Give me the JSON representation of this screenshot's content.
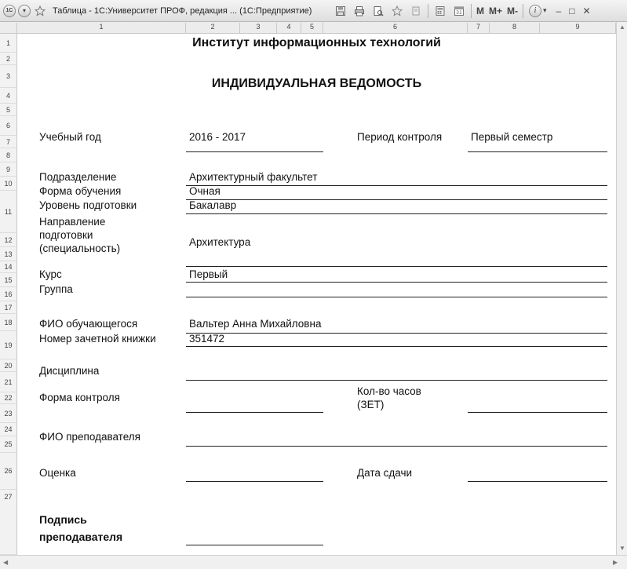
{
  "window": {
    "title": "Таблица - 1С:Университет ПРОФ, редакция ... (1С:Предприятие)",
    "m_label": "M",
    "m_plus_label": "M+",
    "m_minus_label": "M-",
    "app_icon": "1c-logo-icon",
    "back_icon": "circle-left-icon",
    "forward_icon": "circle-right-icon",
    "star_icon": "star-icon",
    "save_icon": "save-icon",
    "print_icon": "print-icon",
    "preview_icon": "print-preview-icon",
    "favorites_icon": "star-icon",
    "copy_icon": "copy-icon",
    "calculator_icon": "calculator-icon",
    "calendar_icon": "calendar-icon",
    "info_icon": "info-icon",
    "minimize_label": "–",
    "maximize_label": "□",
    "close_label": "✕"
  },
  "columns": [
    "1",
    "2",
    "3",
    "4",
    "5",
    "6",
    "7",
    "8",
    "9"
  ],
  "rows": [
    "1",
    "2",
    "3",
    "4",
    "5",
    "6",
    "7",
    "8",
    "9",
    "10",
    "11",
    "12",
    "13",
    "14",
    "15",
    "16",
    "17",
    "18",
    "19",
    "20",
    "21",
    "22",
    "23",
    "24",
    "25",
    "26",
    "27"
  ],
  "report": {
    "institute": "Институт информационных технологий",
    "title": "ИНДИВИДУАЛЬНАЯ ВЕДОМОСТЬ",
    "academic_year_label": "Учебный год",
    "academic_year_value": "2016 - 2017",
    "control_period_label": "Период контроля",
    "control_period_value": "Первый семестр",
    "department_label": "Подразделение",
    "department_value": "Архитектурный факультет",
    "study_form_label": "Форма обучения",
    "study_form_value": "Очная",
    "level_label": "Уровень подготовки",
    "level_value": "Бакалавр",
    "direction_label_1": "Направление",
    "direction_label_2": "подготовки",
    "direction_label_3": "(специальность)",
    "direction_value": "Архитектура",
    "course_label": "Курс",
    "course_value": "Первый",
    "group_label": "Группа",
    "student_label": "ФИО обучающегося",
    "student_value": "Вальтер Анна Михайловна",
    "record_book_label": "Номер зачетной книжки",
    "record_book_value": "351472",
    "discipline_label": "Дисциплина",
    "control_form_label": "Форма контроля",
    "hours_label_1": "Кол-во часов",
    "hours_label_2": "(ЗЕТ)",
    "teacher_label": "ФИО преподавателя",
    "grade_label": "Оценка",
    "submission_date_label": "Дата сдачи",
    "signature_label_1": "Подпись",
    "signature_label_2": "преподавателя"
  }
}
